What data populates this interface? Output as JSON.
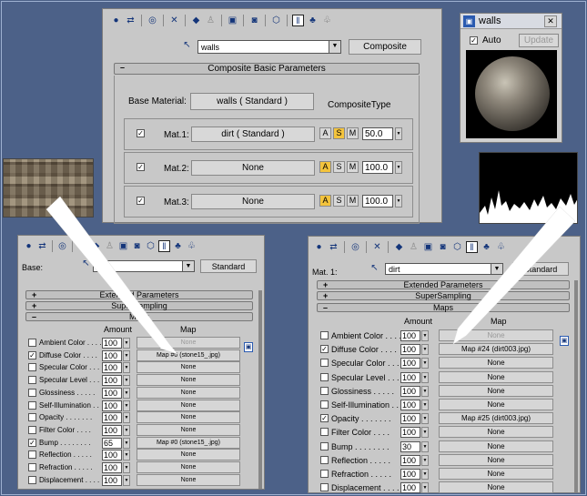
{
  "top_editor": {
    "material_name": "walls",
    "type_button": "Composite",
    "rollout_title": "Composite Basic Parameters",
    "base_material_label": "Base Material:",
    "base_material_value": "walls  ( Standard )",
    "composite_type_label": "CompositeType",
    "rows": [
      {
        "checked": true,
        "label": "Mat.1:",
        "material": "dirt  ( Standard )",
        "active": "S",
        "value": "50.0"
      },
      {
        "checked": true,
        "label": "Mat.2:",
        "material": "None",
        "active": "A",
        "value": "100.0"
      },
      {
        "checked": true,
        "label": "Mat.3:",
        "material": "None",
        "active": "A",
        "value": "100.0"
      }
    ],
    "mode_letters": [
      "A",
      "S",
      "M"
    ],
    "minus": "–"
  },
  "preview": {
    "title": "walls",
    "auto_label": "Auto",
    "update_label": "Update",
    "close": "✕"
  },
  "left_editor": {
    "base_label": "Base:",
    "type_button": "Standard",
    "rollouts": [
      {
        "sign": "+",
        "title": "Extended Parameters"
      },
      {
        "sign": "+",
        "title": "SuperSampling"
      },
      {
        "sign": "–",
        "title": "Maps"
      }
    ],
    "amount_header": "Amount",
    "map_header": "Map",
    "rows": [
      {
        "checked": false,
        "label": "Ambient Color . . . .",
        "amount": "100",
        "map": "None",
        "disabled": true
      },
      {
        "checked": true,
        "label": "Diffuse Color . . . .",
        "amount": "100",
        "map": "Map #0 (stone15_.jpg)"
      },
      {
        "checked": false,
        "label": "Specular Color . . .",
        "amount": "100",
        "map": "None"
      },
      {
        "checked": false,
        "label": "Specular Level . . .",
        "amount": "100",
        "map": "None"
      },
      {
        "checked": false,
        "label": "Glossiness . . . . .",
        "amount": "100",
        "map": "None"
      },
      {
        "checked": false,
        "label": "Self-Illumination . .",
        "amount": "100",
        "map": "None"
      },
      {
        "checked": false,
        "label": "Opacity . . . . . . .",
        "amount": "100",
        "map": "None"
      },
      {
        "checked": false,
        "label": "Filter Color . . . .",
        "amount": "100",
        "map": "None"
      },
      {
        "checked": true,
        "label": "Bump . . . . . . . .",
        "amount": "65",
        "map": "Map #0 (stone15_.jpg)"
      },
      {
        "checked": false,
        "label": "Reflection . . . . .",
        "amount": "100",
        "map": "None"
      },
      {
        "checked": false,
        "label": "Refraction . . . . .",
        "amount": "100",
        "map": "None"
      },
      {
        "checked": false,
        "label": "Displacement . . . .",
        "amount": "100",
        "map": "None"
      }
    ]
  },
  "right_editor": {
    "mat_label": "Mat. 1:",
    "material_name": "dirt",
    "type_button": "Standard",
    "rollouts": [
      {
        "sign": "+",
        "title": "Extended Parameters"
      },
      {
        "sign": "+",
        "title": "SuperSampling"
      },
      {
        "sign": "–",
        "title": "Maps"
      }
    ],
    "amount_header": "Amount",
    "map_header": "Map",
    "rows": [
      {
        "checked": false,
        "label": "Ambient Color . . . .",
        "amount": "100",
        "map": "None",
        "disabled": true
      },
      {
        "checked": true,
        "label": "Diffuse Color . . . .",
        "amount": "100",
        "map": "Map #24 (dirt003.jpg)"
      },
      {
        "checked": false,
        "label": "Specular Color . . .",
        "amount": "100",
        "map": "None"
      },
      {
        "checked": false,
        "label": "Specular Level . . .",
        "amount": "100",
        "map": "None"
      },
      {
        "checked": false,
        "label": "Glossiness . . . . .",
        "amount": "100",
        "map": "None"
      },
      {
        "checked": false,
        "label": "Self-Illumination . .",
        "amount": "100",
        "map": "None"
      },
      {
        "checked": true,
        "label": "Opacity . . . . . . .",
        "amount": "100",
        "map": "Map #25 (dirt003.jpg)"
      },
      {
        "checked": false,
        "label": "Filter Color . . . .",
        "amount": "100",
        "map": "None"
      },
      {
        "checked": false,
        "label": "Bump . . . . . . . .",
        "amount": "30",
        "map": "None"
      },
      {
        "checked": false,
        "label": "Reflection . . . . .",
        "amount": "100",
        "map": "None"
      },
      {
        "checked": false,
        "label": "Refraction . . . . .",
        "amount": "100",
        "map": "None"
      },
      {
        "checked": false,
        "label": "Displacement . . . .",
        "amount": "100",
        "map": "None"
      }
    ]
  },
  "colors": {
    "background": "#4c6188",
    "panel": "#c8c8c8",
    "active_mode": "#f3c33c",
    "window_title": "#2a5ab0"
  },
  "icons": [
    "get-material-icon",
    "put-to-scene-icon",
    "assign-icon",
    "reset-icon",
    "make-unique-icon",
    "put-library-icon",
    "material-id-icon",
    "show-map-icon",
    "show-end-result-icon",
    "go-parent-icon",
    "go-sibling-icon",
    "pick-material-icon"
  ],
  "check_mark": "✓",
  "arrow_down": "▼"
}
